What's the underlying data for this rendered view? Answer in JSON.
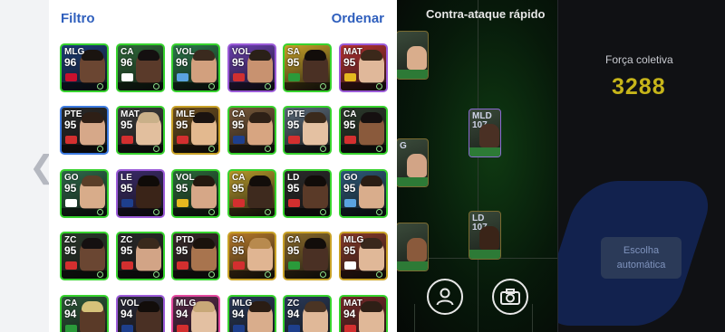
{
  "left_nav": {
    "back_icon": "chevron-left-icon"
  },
  "list_panel": {
    "filter_label": "Filtro",
    "sort_label": "Ordenar",
    "players": [
      {
        "pos": "MLG",
        "ovr": "96",
        "border": "#37d32e",
        "bg": "#1c3e7a",
        "skin": "#6b4632",
        "hair": "#1a1410",
        "badge": "#c8102e"
      },
      {
        "pos": "CA",
        "ovr": "96",
        "border": "#37d32e",
        "bg": "#2f6b3a",
        "skin": "#5a3a2a",
        "hair": "#141010",
        "badge": "#ffffff"
      },
      {
        "pos": "VOL",
        "ovr": "96",
        "border": "#37d32e",
        "bg": "#2b7a4b",
        "skin": "#d2a07e",
        "hair": "#3a2a1e",
        "badge": "#5aa3e0"
      },
      {
        "pos": "VOL",
        "ovr": "95",
        "border": "#9b5bd8",
        "bg": "#6a3fb0",
        "skin": "#c89270",
        "hair": "#2a2018",
        "badge": "#d03030"
      },
      {
        "pos": "SA",
        "ovr": "95",
        "border": "#37d32e",
        "bg": "#c9a227",
        "skin": "#4a3024",
        "hair": "#120d0a",
        "badge": "#2a9a3a"
      },
      {
        "pos": "MAT",
        "ovr": "95",
        "border": "#9b5bd8",
        "bg": "#b83232",
        "skin": "#e0b89a",
        "hair": "#3b281a",
        "badge": "#e5b81f"
      },
      {
        "pos": "PTE",
        "ovr": "95",
        "border": "#3d7be0",
        "bg": "#2a2a2a",
        "skin": "#d6a889",
        "hair": "#2e1f16",
        "badge": "#d32f2f"
      },
      {
        "pos": "MAT",
        "ovr": "95",
        "border": "#37d32e",
        "bg": "#3d3d3d",
        "skin": "#e2bf9e",
        "hair": "#c9b089",
        "badge": "#d32f2f"
      },
      {
        "pos": "MLE",
        "ovr": "95",
        "border": "#c9a227",
        "bg": "#6f4f1e",
        "skin": "#e3b98f",
        "hair": "#1a1310",
        "badge": "#d32f2f"
      },
      {
        "pos": "CA",
        "ovr": "95",
        "border": "#37d32e",
        "bg": "#7a5a3a",
        "skin": "#d7a581",
        "hair": "#2e2016",
        "badge": "#1e3f8c"
      },
      {
        "pos": "PTE",
        "ovr": "95",
        "border": "#37d32e",
        "bg": "#5a6a7a",
        "skin": "#e4c1a2",
        "hair": "#3a2a1c",
        "badge": "#d32f2f"
      },
      {
        "pos": "CA",
        "ovr": "95",
        "border": "#37d32e",
        "bg": "#2c3a2c",
        "skin": "#8a5a3c",
        "hair": "#151010",
        "badge": "#d32f2f"
      },
      {
        "pos": "GO",
        "ovr": "95",
        "border": "#37d32e",
        "bg": "#2e6a4a",
        "skin": "#d8ac8a",
        "hair": "#5a3e28",
        "badge": "#ffffff"
      },
      {
        "pos": "LE",
        "ovr": "95",
        "border": "#9b5bd8",
        "bg": "#3b2a6a",
        "skin": "#3a2418",
        "hair": "#0f0b08",
        "badge": "#1e3f8c"
      },
      {
        "pos": "VOL",
        "ovr": "95",
        "border": "#37d32e",
        "bg": "#2b6a3a",
        "skin": "#d6a787",
        "hair": "#24190f",
        "badge": "#e5b81f"
      },
      {
        "pos": "CA",
        "ovr": "95",
        "border": "#37d32e",
        "bg": "#b89a2a",
        "skin": "#3e2a1e",
        "hair": "#120d0a",
        "badge": "#d32f2f"
      },
      {
        "pos": "LD",
        "ovr": "95",
        "border": "#37d32e",
        "bg": "#2a2a2a",
        "skin": "#5a3a28",
        "hair": "#110c09",
        "badge": "#d32f2f"
      },
      {
        "pos": "GO",
        "ovr": "95",
        "border": "#37d32e",
        "bg": "#2d5a7a",
        "skin": "#d9ad8c",
        "hair": "#2a1d14",
        "badge": "#5aa3e0"
      },
      {
        "pos": "ZC",
        "ovr": "95",
        "border": "#37d32e",
        "bg": "#2c3a2c",
        "skin": "#6a4632",
        "hair": "#151010",
        "badge": "#d32f2f"
      },
      {
        "pos": "ZC",
        "ovr": "95",
        "border": "#37d32e",
        "bg": "#2a2a2a",
        "skin": "#d2a486",
        "hair": "#3a2a1c",
        "badge": "#d32f2f"
      },
      {
        "pos": "PTD",
        "ovr": "95",
        "border": "#37d32e",
        "bg": "#3a2a2a",
        "skin": "#a8744e",
        "hair": "#1a120c",
        "badge": "#d32f2f"
      },
      {
        "pos": "SA",
        "ovr": "95",
        "border": "#c9a227",
        "bg": "#b87a2a",
        "skin": "#e0b592",
        "hair": "#b88a4e",
        "badge": "#d32f2f"
      },
      {
        "pos": "CA",
        "ovr": "95",
        "border": "#c9a227",
        "bg": "#8a6a2a",
        "skin": "#4a3024",
        "hair": "#120d0a",
        "badge": "#2a9a3a"
      },
      {
        "pos": "MLG",
        "ovr": "95",
        "border": "#c9a227",
        "bg": "#8a3a2a",
        "skin": "#e0b898",
        "hair": "#3a281c",
        "badge": "#ffffff"
      },
      {
        "pos": "CA",
        "ovr": "94",
        "border": "#37d32e",
        "bg": "#2c5a3a",
        "skin": "#5a3a28",
        "hair": "#d6c27a",
        "badge": "#2a9a3a"
      },
      {
        "pos": "VOL",
        "ovr": "94",
        "border": "#9b5bd8",
        "bg": "#2a2a3a",
        "skin": "#4a3024",
        "hair": "#120d0a",
        "badge": "#1e3f8c"
      },
      {
        "pos": "MLG",
        "ovr": "94",
        "border": "#e34aa0",
        "bg": "#5a2a4a",
        "skin": "#e3c0a2",
        "hair": "#c8a878",
        "badge": "#d32f2f"
      },
      {
        "pos": "MLG",
        "ovr": "94",
        "border": "#37d32e",
        "bg": "#2a3a5a",
        "skin": "#d9ad8c",
        "hair": "#2a1d14",
        "badge": "#1e3f8c"
      },
      {
        "pos": "ZC",
        "ovr": "94",
        "border": "#37d32e",
        "bg": "#2a3a5a",
        "skin": "#e0b898",
        "hair": "#4a3424",
        "badge": "#1e3f8c"
      },
      {
        "pos": "MAT",
        "ovr": "94",
        "border": "#37d32e",
        "bg": "#7a2a2a",
        "skin": "#e0b898",
        "hair": "#2e1f16",
        "badge": "#d32f2f"
      }
    ]
  },
  "field": {
    "formation_title": "Contra-ataque rápido",
    "cards": [
      {
        "stat": "",
        "skin": "#d9ad8c"
      },
      {
        "stat": "MLD\n107",
        "skin": "#4a3024"
      },
      {
        "stat": "G",
        "skin": "#d2a486"
      },
      {
        "stat": "LD\n107",
        "skin": "#3a2418"
      },
      {
        "stat": "",
        "skin": "#8a5a3c"
      }
    ],
    "profile_icon": "person-icon",
    "camera_icon": "camera-icon"
  },
  "right_panel": {
    "strength_label": "Força coletiva",
    "strength_value": "3288",
    "auto_button_label": "Escolha automática"
  }
}
